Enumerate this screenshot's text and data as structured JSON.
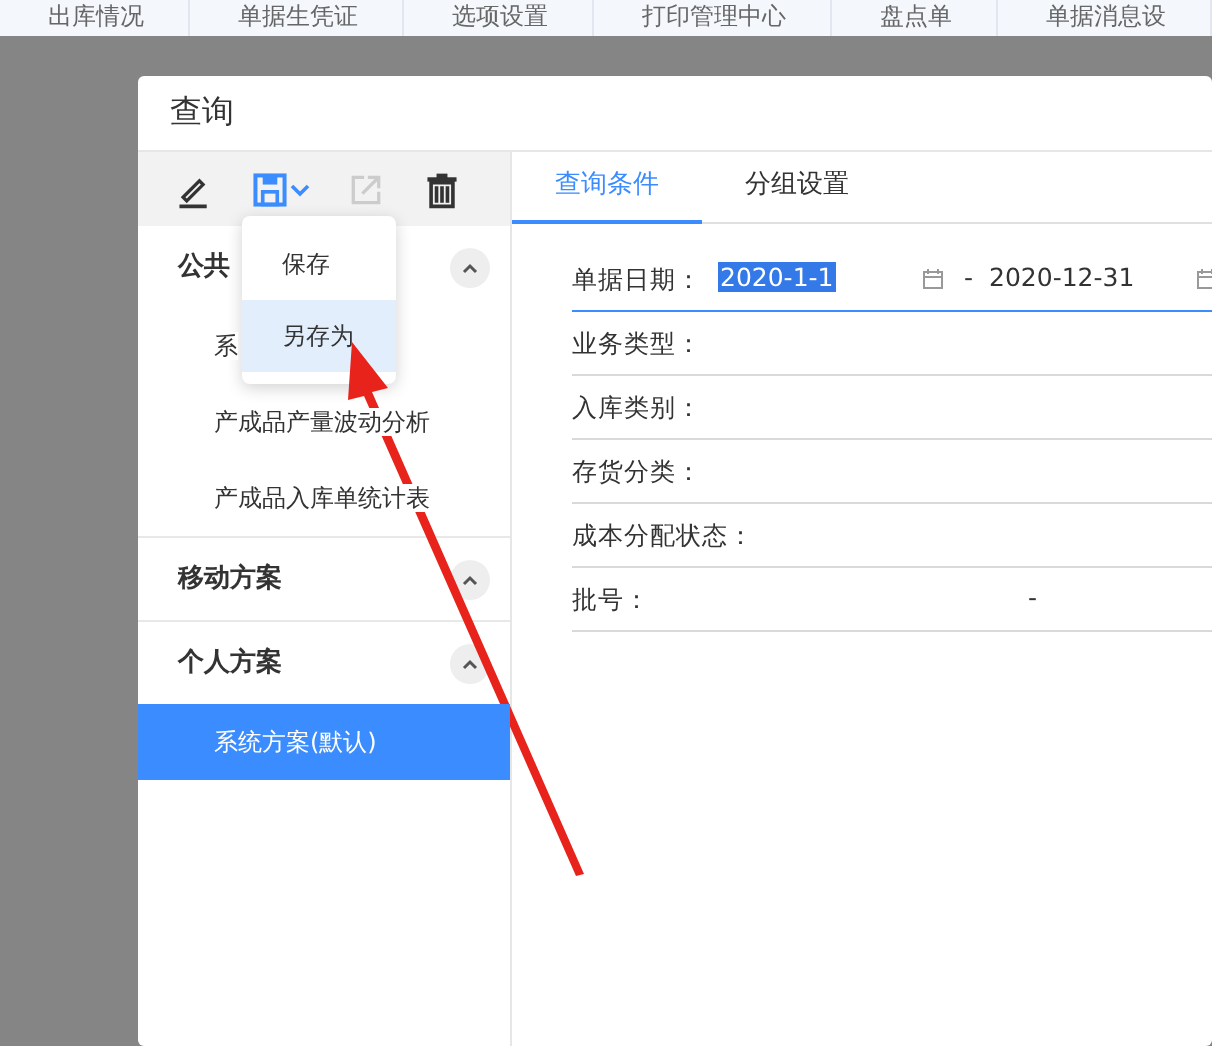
{
  "top_tabs": [
    "出库情况",
    "单据生凭证",
    "选项设置",
    "打印管理中心",
    "盘点单",
    "单据消息设"
  ],
  "dialog": {
    "title": "查询",
    "toolbar": [
      {
        "kind": "edit",
        "disabled": false
      },
      {
        "kind": "save",
        "disabled": false
      },
      {
        "kind": "export",
        "disabled": true
      },
      {
        "kind": "delete",
        "disabled": false
      }
    ],
    "save_menu": [
      {
        "label": "保存",
        "selected": false
      },
      {
        "label": "另存为",
        "selected": true
      }
    ],
    "groups": [
      {
        "label": "公共",
        "expanded": true,
        "items": [
          {
            "label": "系",
            "selected": false
          },
          {
            "label": "产成品产量波动分析",
            "selected": false
          },
          {
            "label": "产成品入库单统计表",
            "selected": false
          }
        ]
      },
      {
        "label": "移动方案",
        "expanded": true
      },
      {
        "label": "个人方案",
        "expanded": true,
        "items": [
          {
            "label": "系统方案(默认)",
            "selected": true
          }
        ]
      }
    ],
    "tabs": [
      {
        "label": "查询条件",
        "selected": true
      },
      {
        "label": "分组设置",
        "selected": false
      }
    ],
    "fields": [
      {
        "kind": "date_range",
        "label": "单据日期：",
        "from": "2020-1-1",
        "separator": "-",
        "to": "2020-12-31",
        "focused": true
      },
      {
        "kind": "text",
        "label": "业务类型：",
        "focused": false
      },
      {
        "kind": "text",
        "label": "入库类别：",
        "focused": false
      },
      {
        "kind": "text",
        "label": "存货分类：",
        "focused": false
      },
      {
        "kind": "text",
        "label": "成本分配状态：",
        "focused": false
      },
      {
        "kind": "range",
        "label": "批号：",
        "separator": "-",
        "focused": false
      }
    ]
  }
}
